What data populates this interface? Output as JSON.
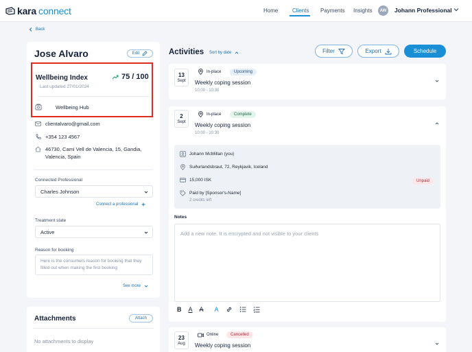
{
  "nav": {
    "logo_bold": "kara",
    "logo_light": "connect",
    "links": [
      "Home",
      "Clients",
      "Payments",
      "Insights"
    ],
    "active_link": "Clients",
    "avatar_initials": "AW",
    "user_name": "Johann Professional"
  },
  "back_label": "Back",
  "client": {
    "name": "Jose Alvaro",
    "edit_label": "Edit",
    "wellbeing": {
      "title": "Wellbeing Index",
      "score": "75 / 100",
      "updated": "Last updated 27/01/2024",
      "hub_label": "Wellbeing Hub"
    },
    "email": "clientalvaro@gmail.com",
    "phone": "+354 123 4567",
    "address": "46730, Cami Vell de Valencia, 15, Gandia, Valencia, Spain",
    "connected_professional_label": "Connected Professional",
    "connected_professional_value": "Charles Johnson",
    "connect_link": "Connect a professional",
    "treatment_label": "Treatment state",
    "treatment_value": "Active",
    "reason_label": "Reason for booking",
    "reason_placeholder": "Here is the consumers reason for booking that they filled out when making the first booking",
    "see_more": "See more"
  },
  "attachments": {
    "title": "Attachments",
    "attach_label": "Attach",
    "empty_text": "No attachments to display"
  },
  "activities": {
    "title": "Activities",
    "sort_label": "Sort by date",
    "filter_label": "Filter",
    "export_label": "Export",
    "schedule_label": "Schedule",
    "sessions": [
      {
        "day": "13",
        "month": "Sept",
        "location": "In-place",
        "status": "Upcoming",
        "title": "Weekly coping session",
        "time": "10:00 - 10:30"
      },
      {
        "day": "2",
        "month": "Sept",
        "location": "In-place",
        "status": "Complete",
        "title": "Weekly coping session",
        "time": "10:00 - 10:30"
      },
      {
        "day": "23",
        "month": "Aug",
        "location": "Online",
        "status": "Cancelled",
        "title": "Weekly coping session",
        "time": ""
      }
    ],
    "details": {
      "professional": "Johann McMillan (you)",
      "address": "Suðurlandsbraut, 72, Reykjavik, Iceland",
      "price": "15,000 ISK",
      "payment_status": "Unpaid",
      "paid_by": "Paid by [Sponsor's-Name]",
      "credits": "2 credits left"
    },
    "notes_label": "Notes",
    "notes_placeholder": "Add a new note. It is encrypted and not visible to your clients"
  },
  "colors": {
    "accent": "#1a8fd6",
    "highlight": "#e02b1f",
    "background": "#f3f5f8"
  }
}
